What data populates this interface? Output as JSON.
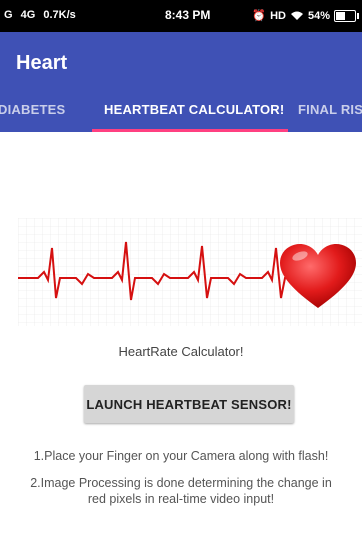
{
  "status_bar": {
    "carrier": "G",
    "network": "4G",
    "speed": "0.7K/s",
    "time": "8:43 PM",
    "hd": "HD",
    "battery": "54%"
  },
  "app": {
    "title": "Heart",
    "primary_color": "#3f51b5",
    "accent_color": "#ff4081"
  },
  "tabs": [
    {
      "label": "DIABETES"
    },
    {
      "label": "HEARTBEAT CALCULATOR!"
    },
    {
      "label": "FINAL RIS"
    }
  ],
  "main": {
    "graphic_icon": "heartbeat-ecg-heart-icon",
    "caption": "HeartRate Calculator!",
    "launch_label": "LAUNCH HEARTBEAT SENSOR!",
    "instruction_1": "1.Place your Finger on your Camera along with flash!",
    "instruction_2a": "2.Image Processing is done determining the change in",
    "instruction_2b": "red pixels in real-time video input!"
  }
}
